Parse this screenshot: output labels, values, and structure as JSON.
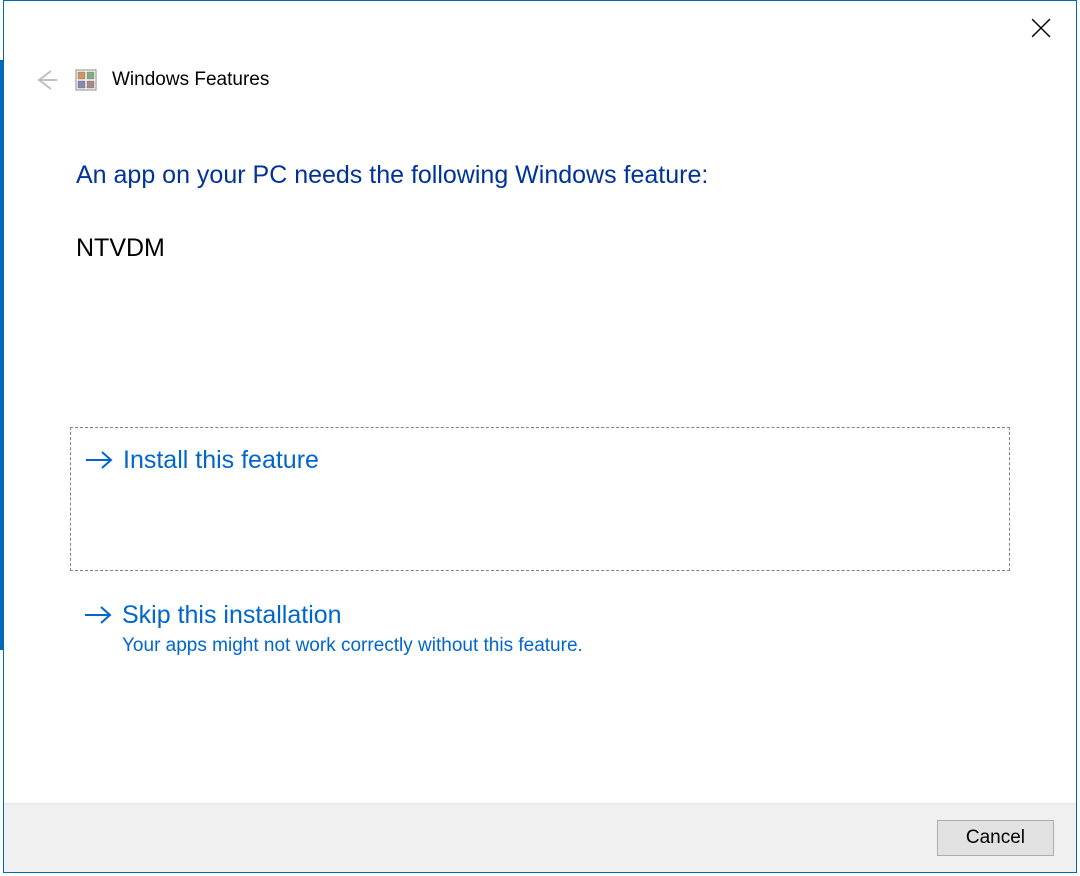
{
  "window": {
    "title": "Windows Features"
  },
  "content": {
    "heading": "An app on your PC needs the following Windows feature:",
    "feature_name": "NTVDM"
  },
  "options": {
    "install": {
      "title": "Install this feature"
    },
    "skip": {
      "title": "Skip this installation",
      "subtitle": "Your apps might not work correctly without this feature."
    }
  },
  "footer": {
    "cancel": "Cancel"
  }
}
